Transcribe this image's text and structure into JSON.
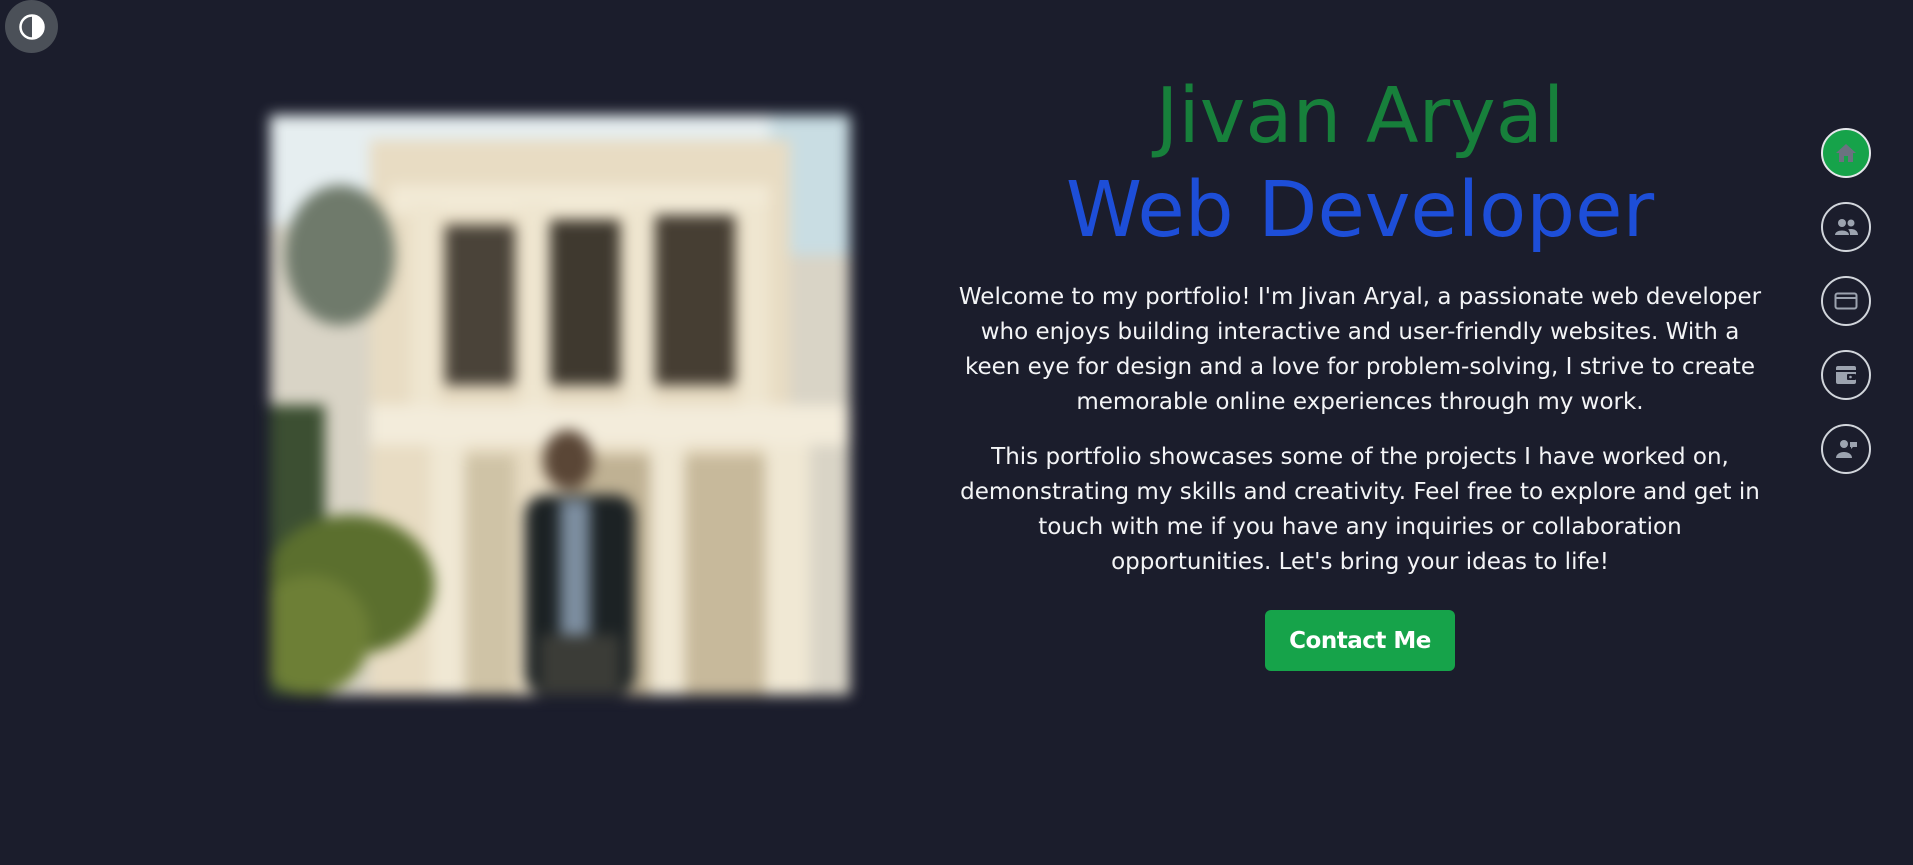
{
  "theme_toggle": {
    "icon": "contrast-icon"
  },
  "hero": {
    "name": "Jivan Aryal",
    "role": "Web Developer",
    "intro": "Welcome to my portfolio! I'm Jivan Aryal, a passionate web developer who enjoys building interactive and user-friendly websites. With a keen eye for design and a love for problem-solving, I strive to create memorable online experiences through my work.",
    "about": "This portfolio showcases some of the projects I have worked on, demonstrating my skills and creativity. Feel free to explore and get in touch with me if you have any inquiries or collaboration opportunities. Let's bring your ideas to life!",
    "contact_label": "Contact Me"
  },
  "side_nav": {
    "items": [
      {
        "icon": "home-icon",
        "active": true
      },
      {
        "icon": "users-icon",
        "active": false
      },
      {
        "icon": "card-icon",
        "active": false
      },
      {
        "icon": "wallet-icon",
        "active": false
      },
      {
        "icon": "contact-icon",
        "active": false
      }
    ]
  },
  "colors": {
    "background": "#1b1d2c",
    "name": "#17803b",
    "role": "#1d4ed8",
    "accent": "#16a34a",
    "text": "#f3f4f6",
    "nav_icon": "#9ca3af"
  }
}
